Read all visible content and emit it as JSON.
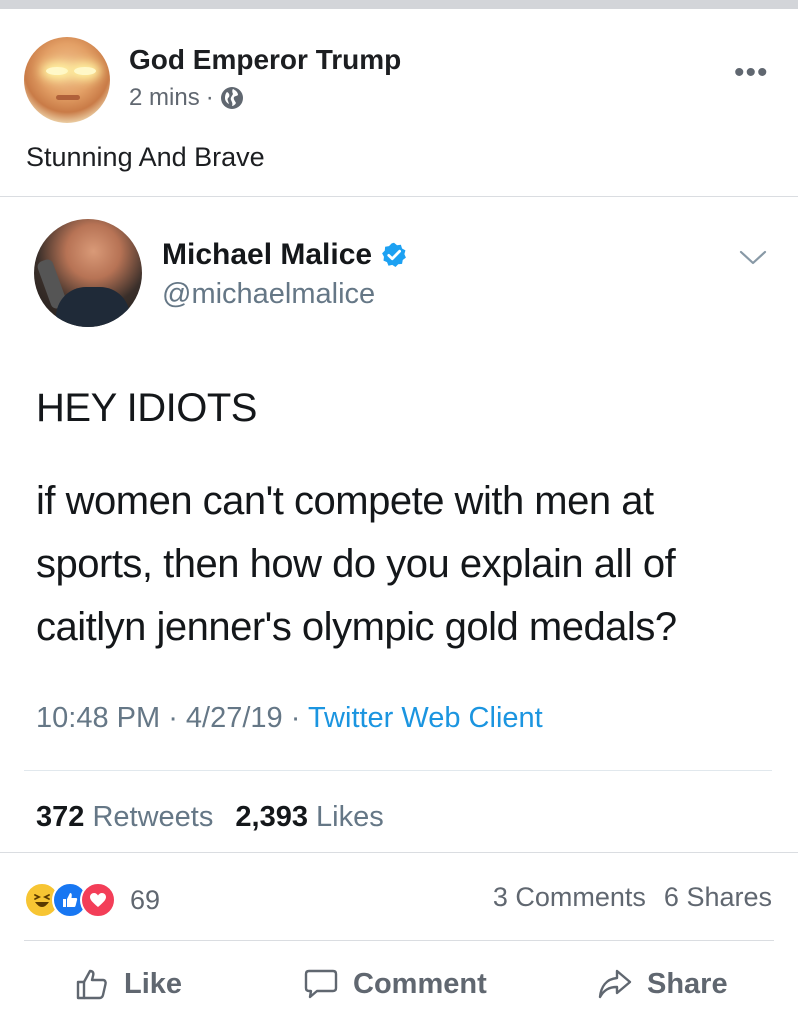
{
  "post": {
    "author": "God Emperor Trump",
    "time": "2 mins",
    "separator": "·",
    "caption": "Stunning And Brave"
  },
  "tweet": {
    "name": "Michael Malice",
    "handle": "@michaelmalice",
    "headline": "HEY IDIOTS",
    "body": "if women can't compete with men at sports, then how do you explain all of caitlyn jenner's olympic gold medals?",
    "time": "10:48 PM",
    "date": "4/27/19",
    "client": "Twitter Web Client",
    "meta_sep": " · ",
    "retweets_count": "372",
    "retweets_label": "Retweets",
    "likes_count": "2,393",
    "likes_label": "Likes"
  },
  "engagement": {
    "reaction_count": "69",
    "reactions": [
      "haha-icon",
      "like-icon",
      "love-icon"
    ],
    "comments": "3 Comments",
    "shares": "6 Shares"
  },
  "actions": {
    "like": "Like",
    "comment": "Comment",
    "share": "Share"
  },
  "colors": {
    "twitter_blue": "#1b95e0",
    "facebook_blue": "#1877f2",
    "love_red": "#f33e58",
    "haha_yellow": "#f7c533"
  }
}
